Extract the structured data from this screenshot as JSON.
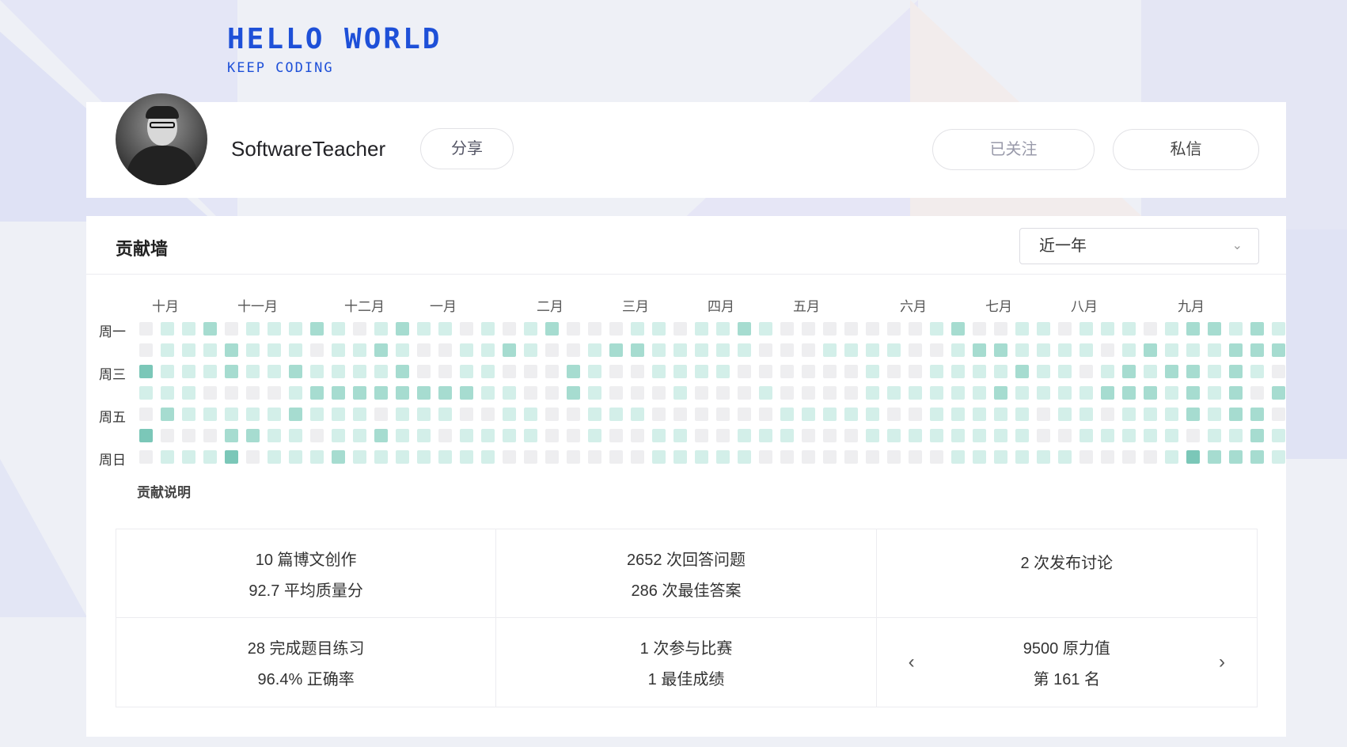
{
  "brand": {
    "title": "HELLO WORLD",
    "subtitle": "KEEP CODING"
  },
  "profile": {
    "username": "SoftwareTeacher",
    "share_label": "分享",
    "followed_label": "已关注",
    "message_label": "私信"
  },
  "contrib": {
    "title": "贡献墙",
    "range_value": "近一年",
    "legend_link": "贡献说明",
    "months": [
      "十月",
      "十一月",
      "十二月",
      "一月",
      "二月",
      "三月",
      "四月",
      "五月",
      "六月",
      "七月",
      "八月",
      "九月"
    ],
    "month_week_index": [
      0,
      4,
      9,
      13,
      18,
      22,
      26,
      30,
      35,
      39,
      43,
      48
    ],
    "weekdays": [
      "周一",
      "周三",
      "周五",
      "周日"
    ],
    "weekday_row_index": [
      0,
      2,
      4,
      6
    ],
    "colors": [
      "#eeeef0",
      "#d3efe9",
      "#a6dcd0",
      "#7bc7b8"
    ],
    "levels": [
      "0112011121012110101200011011210000000120011011101221212",
      "0111211101121001121001221111100011110012211110121112221",
      "3111211211112001100021001111000000100111121101212212103",
      "1110000122222222110021000100010000111111211112221212021",
      "0211111211101110011001110000001111100111110110111212201",
      "3000221101121101111001001100111000111111110011111011210",
      "0111301112111111100000001111100000000011111100001322212"
    ]
  },
  "stats": [
    {
      "line1": "10 篇博文创作",
      "line2": "92.7 平均质量分"
    },
    {
      "line1": "2652 次回答问题",
      "line2": "286 次最佳答案"
    },
    {
      "line1": "2 次发布讨论",
      "line2": ""
    },
    {
      "line1": "28 完成题目练习",
      "line2": "96.4% 正确率"
    },
    {
      "line1": "1 次参与比赛",
      "line2": "1 最佳成绩"
    },
    {
      "line1": "9500 原力值",
      "line2": "第 161 名"
    }
  ],
  "icons": {
    "prev": "chevron-left-icon",
    "next": "chevron-right-icon",
    "dropdown": "chevron-down-icon"
  }
}
